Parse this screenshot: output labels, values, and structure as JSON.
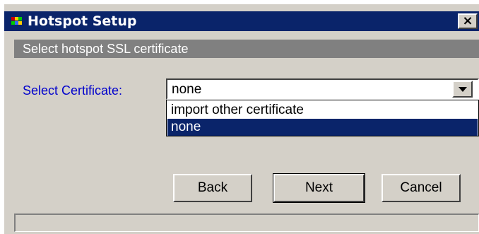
{
  "window": {
    "title": "Hotspot Setup",
    "close_glyph": "×",
    "icons": {
      "app_icon": "app-icon",
      "close_icon": "close-icon",
      "dropdown_arrow": "chevron-down-icon"
    }
  },
  "header": {
    "text": "Select hotspot SSL certificate"
  },
  "form": {
    "certificate_label": "Select Certificate:",
    "certificate_value": "none",
    "options": [
      {
        "label": "import other certificate",
        "selected": false
      },
      {
        "label": "none",
        "selected": true
      }
    ]
  },
  "buttons": {
    "back": "Back",
    "next": "Next",
    "cancel": "Cancel"
  },
  "status": {
    "text": ""
  },
  "colors": {
    "titlebar": "#0a246a",
    "header_band": "#808080",
    "label_blue": "#0000cc",
    "selection": "#0a246a",
    "dialog_bg": "#d4d0c8"
  }
}
